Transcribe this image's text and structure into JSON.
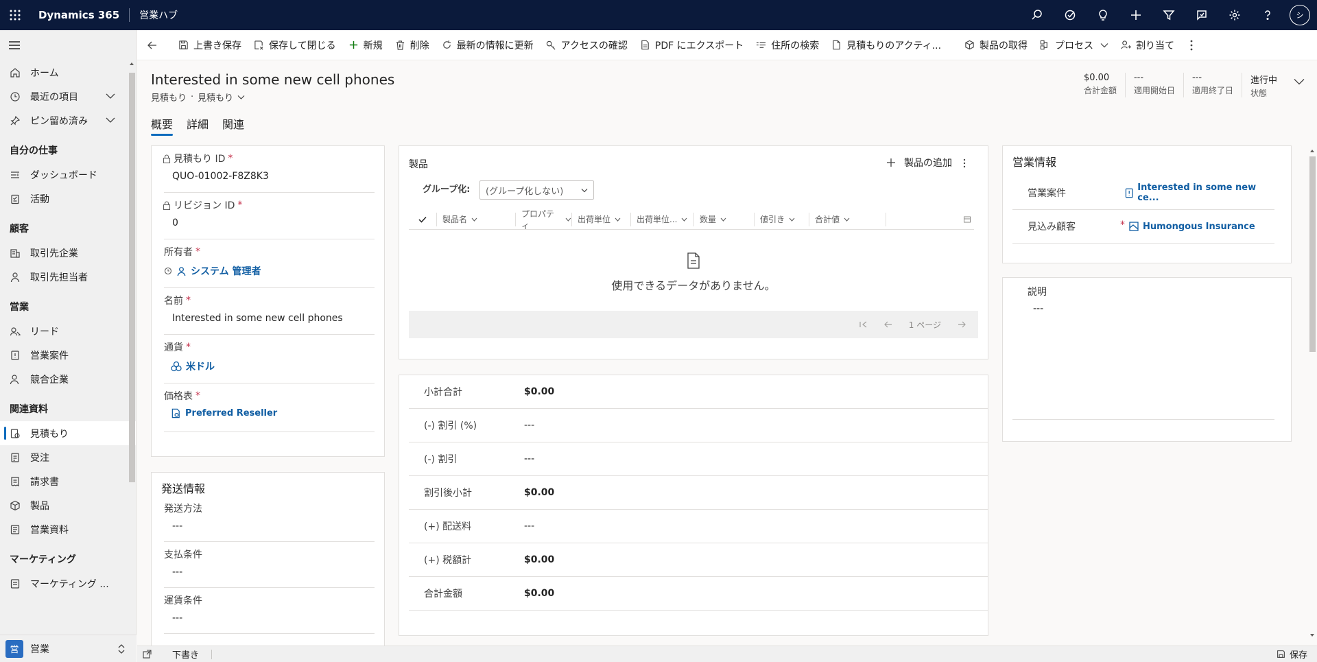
{
  "topbar": {
    "app_title": "Dynamics 365",
    "app_area": "営業ハブ",
    "user_initials": "シ",
    "icons": [
      "search-icon",
      "tasks-icon",
      "lightbulb-icon",
      "plus-icon",
      "filter-icon",
      "assistant-icon",
      "gear-icon",
      "help-icon"
    ]
  },
  "sidebar": {
    "items_top": [
      {
        "label": "ホーム",
        "icon": "home-icon"
      },
      {
        "label": "最近の項目",
        "icon": "clock-icon",
        "has_chevron": true
      },
      {
        "label": "ピン留め済み",
        "icon": "pin-icon",
        "has_chevron": true
      }
    ],
    "groups": [
      {
        "title": "自分の仕事",
        "items": [
          {
            "label": "ダッシュボード",
            "icon": "dashboard-icon"
          },
          {
            "label": "活動",
            "icon": "activity-icon"
          }
        ]
      },
      {
        "title": "顧客",
        "items": [
          {
            "label": "取引先企業",
            "icon": "account-icon"
          },
          {
            "label": "取引先担当者",
            "icon": "contact-icon"
          }
        ]
      },
      {
        "title": "営業",
        "items": [
          {
            "label": "リード",
            "icon": "lead-icon"
          },
          {
            "label": "営業案件",
            "icon": "opportunity-icon"
          },
          {
            "label": "競合企業",
            "icon": "competitor-icon"
          }
        ]
      },
      {
        "title": "関連資料",
        "items": [
          {
            "label": "見積もり",
            "icon": "quote-icon",
            "active": true
          },
          {
            "label": "受注",
            "icon": "order-icon"
          },
          {
            "label": "請求書",
            "icon": "invoice-icon"
          },
          {
            "label": "製品",
            "icon": "product-icon"
          },
          {
            "label": "営業資料",
            "icon": "collateral-icon"
          }
        ]
      },
      {
        "title": "マーケティング",
        "items": [
          {
            "label": "マーケティング ...",
            "icon": "marketing-icon"
          }
        ]
      }
    ],
    "area_badge": "営",
    "area_label": "営業"
  },
  "commands": [
    {
      "label": "上書き保存",
      "icon": "save-icon"
    },
    {
      "label": "保存して閉じる",
      "icon": "save-close-icon"
    },
    {
      "label": "新規",
      "icon": "plus-icon"
    },
    {
      "label": "削除",
      "icon": "delete-icon"
    },
    {
      "label": "最新の情報に更新",
      "icon": "refresh-icon"
    },
    {
      "label": "アクセスの確認",
      "icon": "key-icon"
    },
    {
      "label": "PDF にエクスポート",
      "icon": "pdf-icon"
    },
    {
      "label": "住所の検索",
      "icon": "address-icon"
    },
    {
      "label": "見積もりのアクティ...",
      "icon": "document-icon"
    },
    {
      "label": "製品の取得",
      "icon": "product-icon"
    },
    {
      "label": "プロセス",
      "icon": "process-icon",
      "has_chevron": true
    },
    {
      "label": "割り当て",
      "icon": "assign-icon"
    }
  ],
  "record": {
    "title": "Interested in some new cell phones",
    "entity": "見積もり",
    "form": "見積もり",
    "header_fields": [
      {
        "value": "$0.00",
        "label": "合計金額"
      },
      {
        "value": "---",
        "label": "適用開始日"
      },
      {
        "value": "---",
        "label": "適用終了日"
      },
      {
        "value": "進行中",
        "label": "状態"
      }
    ],
    "tabs": [
      "概要",
      "詳細",
      "関連"
    ]
  },
  "summary_fields": {
    "quote_id": {
      "label": "見積もり ID",
      "value": "QUO-01002-F8Z8K3"
    },
    "revision_id": {
      "label": "リビジョン ID",
      "value": "0"
    },
    "owner": {
      "label": "所有者",
      "value": "システム 管理者"
    },
    "name": {
      "label": "名前",
      "value": "Interested in some new cell phones"
    },
    "currency": {
      "label": "通貨",
      "value": "米ドル"
    },
    "price_list": {
      "label": "価格表",
      "value": "Preferred Reseller"
    }
  },
  "shipping": {
    "title": "発送情報",
    "fields": [
      {
        "label": "発送方法",
        "value": "---"
      },
      {
        "label": "支払条件",
        "value": "---"
      },
      {
        "label": "運賃条件",
        "value": "---"
      }
    ]
  },
  "products": {
    "title": "製品",
    "add_label": "製品の追加",
    "group_label": "グループ化:",
    "group_value": "(グループ化しない)",
    "columns": [
      "製品名",
      "プロパティ",
      "出荷単位",
      "出荷単位...",
      "数量",
      "値引き",
      "合計値"
    ],
    "empty_text": "使用できるデータがありません。",
    "page_label": "1 ページ"
  },
  "totals": [
    {
      "label": "小計合計",
      "value": "$0.00",
      "bold": true
    },
    {
      "label": "(-) 割引 (%)",
      "value": "---"
    },
    {
      "label": "(-) 割引",
      "value": "---"
    },
    {
      "label": "割引後小計",
      "value": "$0.00",
      "bold": true
    },
    {
      "label": "(+) 配送料",
      "value": "---"
    },
    {
      "label": "(+) 税額計",
      "value": "$0.00",
      "bold": true
    },
    {
      "label": "合計金額",
      "value": "$0.00",
      "bold": true
    }
  ],
  "sales_info": {
    "title": "営業情報",
    "opportunity": {
      "label": "営業案件",
      "value": "Interested in some new ce..."
    },
    "prospect": {
      "label": "見込み顧客",
      "value": "Humongous Insurance"
    }
  },
  "description": {
    "label": "説明",
    "value": "---"
  },
  "status_bar": {
    "state": "下書き",
    "save_label": "保存"
  }
}
